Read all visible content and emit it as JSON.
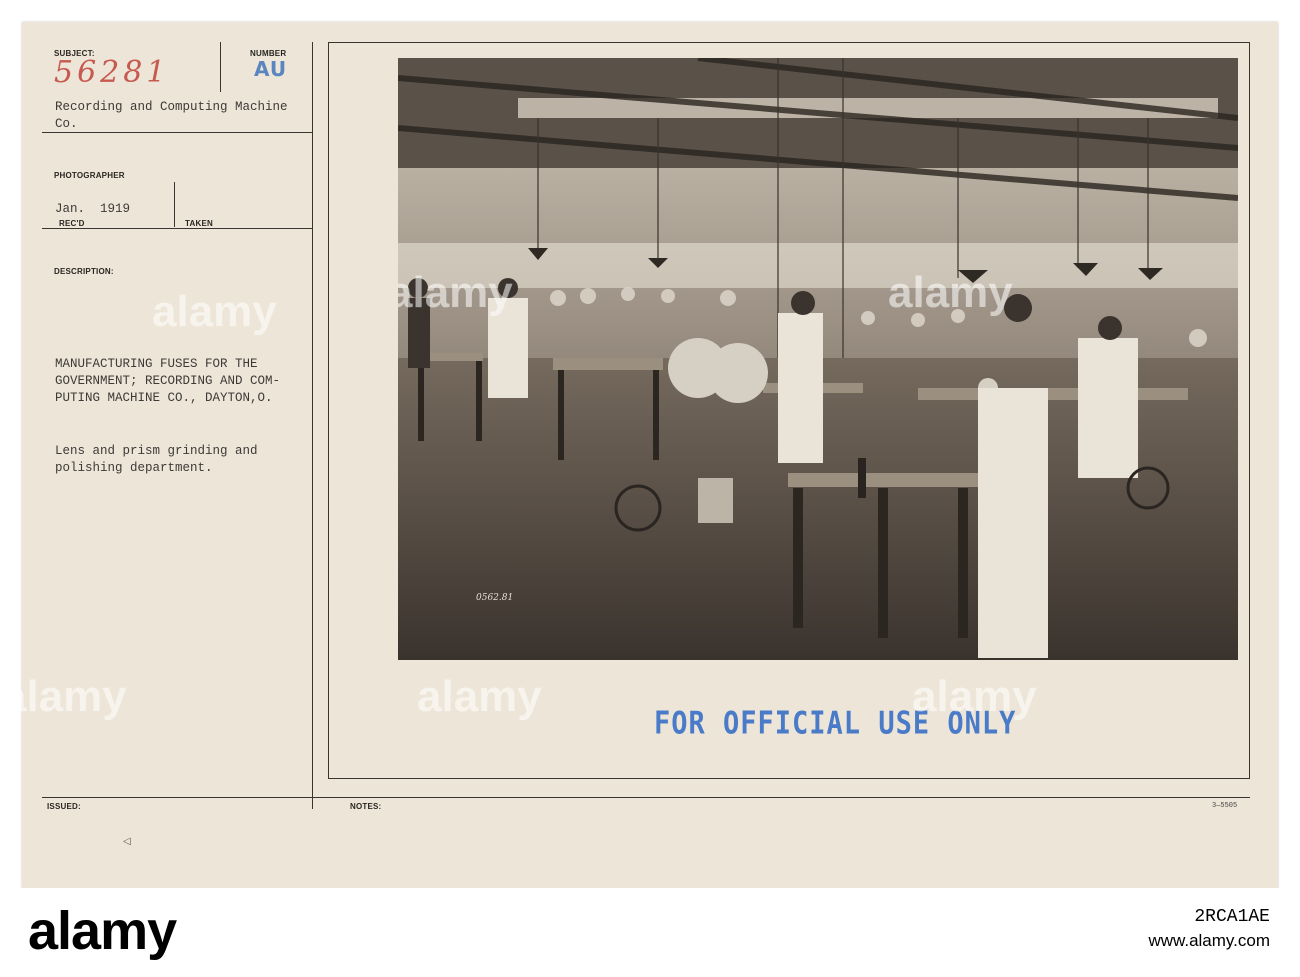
{
  "form": {
    "subject_label": "SUBJECT:",
    "number_label": "NUMBER",
    "photographer_label": "PHOTOGRAPHER",
    "recd_label": "REC'D",
    "taken_label": "TAKEN",
    "description_label": "DESCRIPTION:",
    "issued_label": "ISSUED:",
    "notes_label": "NOTES:"
  },
  "record": {
    "subject_number": "56281",
    "number_stamp": "AU",
    "company_line1": "Recording and Computing Machine",
    "company_line2": "Co.",
    "date_recd": "Jan.  1919",
    "description_line1": "MANUFACTURING FUSES FOR THE",
    "description_line2": "GOVERNMENT; RECORDING AND COM-",
    "description_line3": "PUTING MACHINE CO., DAYTON,O.",
    "detail_line1": "Lens and prism grinding and",
    "detail_line2": "polishing department.",
    "photo_number": "0562.81",
    "stamp": "FOR OFFICIAL USE ONLY",
    "form_code": "3—5505"
  },
  "watermark": {
    "text": "alamy"
  },
  "footer": {
    "logo": "alamy",
    "image_id": "2RCA1AE",
    "url": "www.alamy.com"
  },
  "colors": {
    "card": "#ede5d8",
    "handwriting": "#c65a4f",
    "stamp_blue": "#4a7bc8"
  }
}
